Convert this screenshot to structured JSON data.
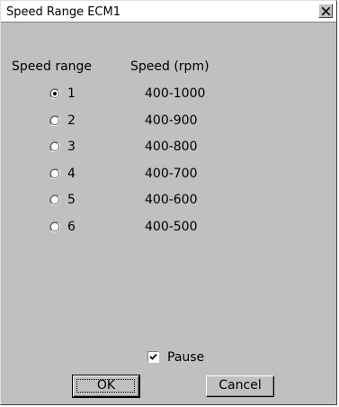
{
  "window": {
    "title": "Speed Range ECM1",
    "close_icon": "close-icon"
  },
  "headers": {
    "speed_range": "Speed range",
    "speed_rpm": "Speed (rpm)"
  },
  "ranges": [
    {
      "label": "1",
      "speed": "400-1000",
      "selected": true
    },
    {
      "label": "2",
      "speed": "400-900",
      "selected": false
    },
    {
      "label": "3",
      "speed": "400-800",
      "selected": false
    },
    {
      "label": "4",
      "speed": "400-700",
      "selected": false
    },
    {
      "label": "5",
      "speed": "400-600",
      "selected": false
    },
    {
      "label": "6",
      "speed": "400-500",
      "selected": false
    }
  ],
  "pause": {
    "label": "Pause",
    "checked": true
  },
  "buttons": {
    "ok": "OK",
    "cancel": "Cancel"
  },
  "colors": {
    "dialog_bg": "#c0c0c0",
    "titlebar_bg": "#ffffff"
  }
}
